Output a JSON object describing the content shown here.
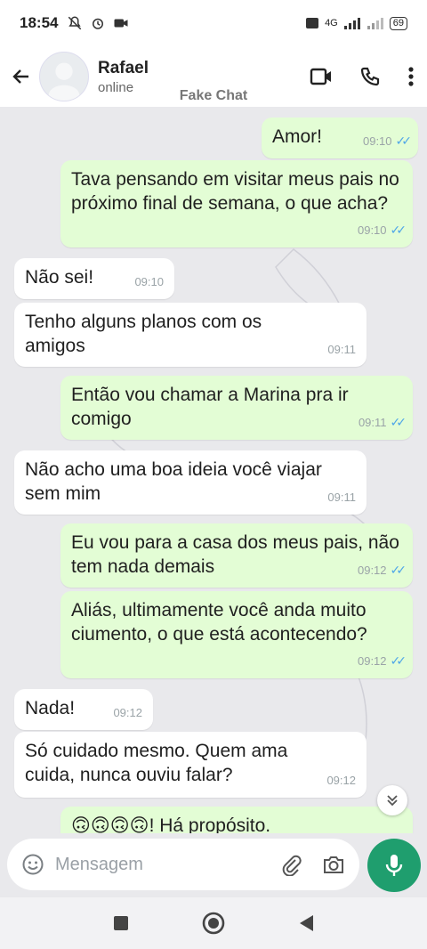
{
  "status_bar": {
    "time": "18:54",
    "network": "4G",
    "battery": "69"
  },
  "header": {
    "contact_name": "Rafael",
    "contact_status": "online",
    "watermark": "Fake Chat"
  },
  "messages": [
    {
      "direction": "out",
      "text": "Amor!",
      "time": "09:10",
      "read": true
    },
    {
      "direction": "out",
      "text": "Tava pensando em visitar meus pais no próximo final de semana, o que acha?",
      "time": "09:10",
      "read": true
    },
    {
      "direction": "in",
      "text": "Não sei!",
      "time": "09:10"
    },
    {
      "direction": "in",
      "text": "Tenho alguns planos com os amigos",
      "time": "09:11"
    },
    {
      "direction": "out",
      "text": "Então vou chamar a Marina pra ir comigo",
      "time": "09:11",
      "read": true
    },
    {
      "direction": "in",
      "text": "Não acho uma boa ideia você viajar sem mim",
      "time": "09:11"
    },
    {
      "direction": "out",
      "text": "Eu vou para a casa dos meus pais, não tem nada demais",
      "time": "09:12",
      "read": true
    },
    {
      "direction": "out",
      "text": "Aliás, ultimamente você anda muito ciumento, o que está acontecendo?",
      "time": "09:12",
      "read": true
    },
    {
      "direction": "in",
      "text": "Nada!",
      "time": "09:12"
    },
    {
      "direction": "in",
      "text": "Só cuidado mesmo. Quem ama cuida, nunca ouviu falar?",
      "time": "09:12"
    },
    {
      "direction": "out",
      "text": "🙃🙃🙃🙃! Há propósito.",
      "time": ""
    }
  ],
  "input": {
    "placeholder": "Mensagem"
  },
  "colors": {
    "outgoing_bubble": "#e3fdd5",
    "incoming_bubble": "#ffffff",
    "accent_green": "#1f9e6e",
    "read_ticks": "#4fa6e8",
    "chat_background": "#e9e9ec"
  },
  "icons": {
    "back": "arrow-left-icon",
    "video_call": "video-camera-icon",
    "voice_call": "phone-icon",
    "menu": "more-vertical-icon",
    "emoji": "smiley-icon",
    "attach": "paperclip-icon",
    "camera": "camera-icon",
    "mic": "microphone-icon",
    "scroll_down": "double-chevron-down-icon"
  }
}
